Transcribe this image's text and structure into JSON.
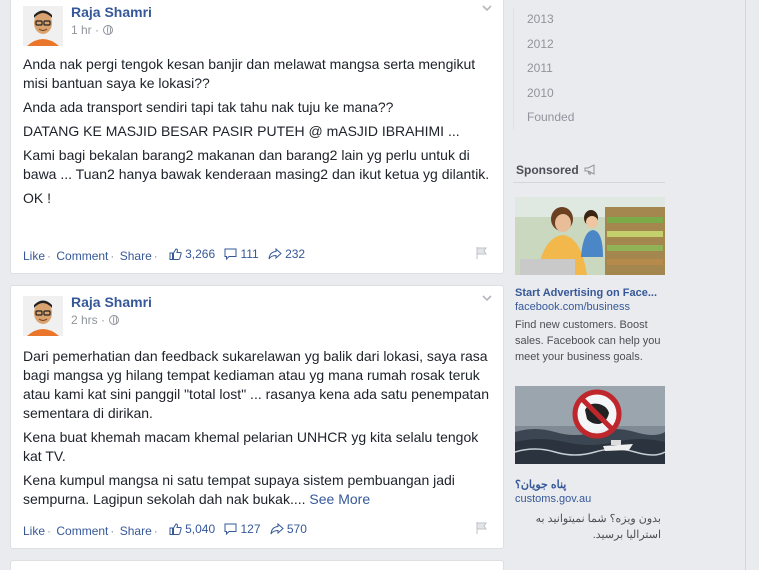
{
  "posts": [
    {
      "author": "Raja Shamri",
      "time": "1 hr",
      "paragraphs": [
        "Anda nak pergi tengok kesan banjir dan melawat mangsa serta mengikut misi bantuan saya ke lokasi??",
        "Anda ada transport sendiri tapi tak tahu nak tuju ke mana??",
        "DATANG KE MASJID BESAR PASIR PUTEH @ mASJID IBRAHIMI ...",
        "Kami bagi bekalan barang2 makanan dan barang2 lain yg perlu untuk di bawa ... Tuan2 hanya bawak kenderaan masing2 dan ikut ketua yg dilantik.",
        "OK !"
      ],
      "like_label": "Like",
      "comment_label": "Comment",
      "share_label": "Share",
      "likes": "3,266",
      "comments": "111",
      "shares": "232"
    },
    {
      "author": "Raja Shamri",
      "time": "2 hrs",
      "paragraphs": [
        "Dari pemerhatian dan feedback sukarelawan yg balik dari lokasi, saya rasa bagi mangsa yg hilang tempat kediaman atau yg mana rumah rosak teruk atau kami kat sini panggil \"total lost\" ... rasanya kena ada satu penempatan sementara di dirikan.",
        "Kena buat khemah macam khemal pelarian UNHCR yg kita selalu tengok kat TV.",
        "Kena kumpul mangsa ni satu tempat supaya sistem pembuangan jadi sempurna. Lagipun sekolah dah nak bukak...."
      ],
      "see_more": "See More",
      "like_label": "Like",
      "comment_label": "Comment",
      "share_label": "Share",
      "likes": "5,040",
      "comments": "127",
      "shares": "570"
    }
  ],
  "timeline_years": [
    "2013",
    "2012",
    "2011",
    "2010",
    "Founded"
  ],
  "sponsored_label": "Sponsored",
  "ads": [
    {
      "title": "Start Advertising on Face...",
      "domain": "facebook.com/business",
      "text": "Find new customers. Boost sales. Facebook can help you meet your business goals."
    },
    {
      "title": "پناه جویان؟",
      "domain": "customs.gov.au",
      "text": "بدون ویزه؟ شما نمیتوانید به استرالیا برسید."
    }
  ],
  "colors": {
    "link": "#365899",
    "muted": "#90949c",
    "background": "#e9ebee"
  }
}
